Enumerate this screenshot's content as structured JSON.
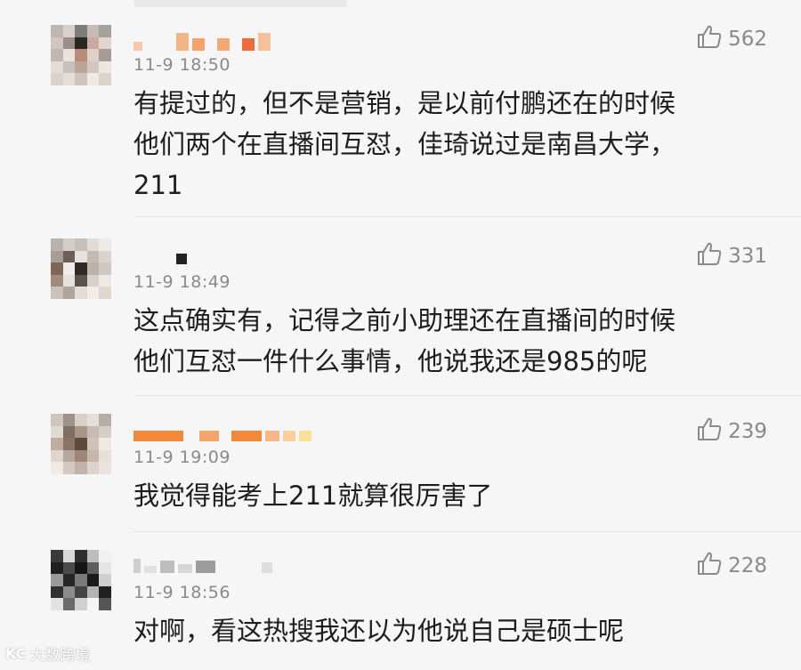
{
  "comments": [
    {
      "time": "11-9 18:50",
      "likes": "562",
      "text": "有提过的，但不是营销，是以前付鹏还在的时候\n他们两个在直播间互怼，佳琦说过是南昌大学，\n211"
    },
    {
      "time": "11-9 18:49",
      "likes": "331",
      "text": "这点确实有，记得之前小助理还在直播间的时候\n他们互怼一件什么事情，他说我还是985的呢"
    },
    {
      "time": "11-9 19:09",
      "likes": "239",
      "text": "我觉得能考上211就算很厉害了"
    },
    {
      "time": "11-9 18:56",
      "likes": "228",
      "text": "对啊，看这热搜我还以为他说自己是硕士呢"
    }
  ],
  "icons": {
    "like": "thumbs-up-icon"
  },
  "watermark": {
    "logo": "KC",
    "text": "大数跨境"
  },
  "colors": {
    "background": "#f6f6f6",
    "text": "#1d1d1d",
    "muted": "#8a8a8a",
    "name_orange": "#f08a3a"
  }
}
